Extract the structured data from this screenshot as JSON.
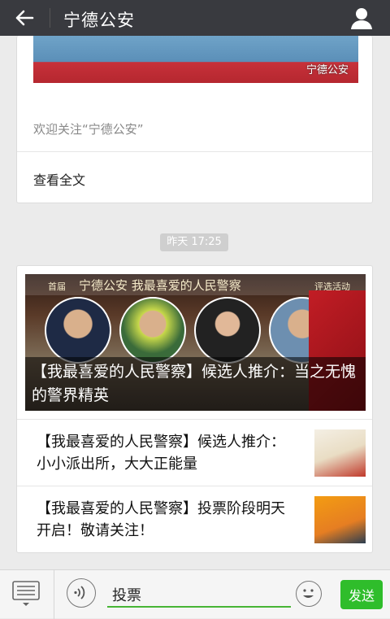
{
  "topbar": {
    "title": "宁德公安"
  },
  "article1": {
    "watermark": "宁德公安",
    "description": "欢迎关注“宁德公安”",
    "view_all": "查看全文"
  },
  "timestamp": "昨天 17:25",
  "article2": {
    "hero_header_left": "首届",
    "hero_header_main": "宁德公安 我最喜爱的人民警察",
    "hero_header_right": "评选活动",
    "hero_caption": "【我最喜爱的人民警察】候选人推介：当之无愧的警界精英",
    "items": [
      {
        "title": "【我最喜爱的人民警察】候选人推介：小小派出所，大大正能量"
      },
      {
        "title": "【我最喜爱的人民警察】投票阶段明天开启！敬请关注！"
      }
    ]
  },
  "input": {
    "value": "投票"
  },
  "send_label": "发送",
  "colors": {
    "topbar": "#393a3f",
    "send": "#2fbd2b",
    "input_underline": "#47b535",
    "background": "#ebebeb"
  }
}
